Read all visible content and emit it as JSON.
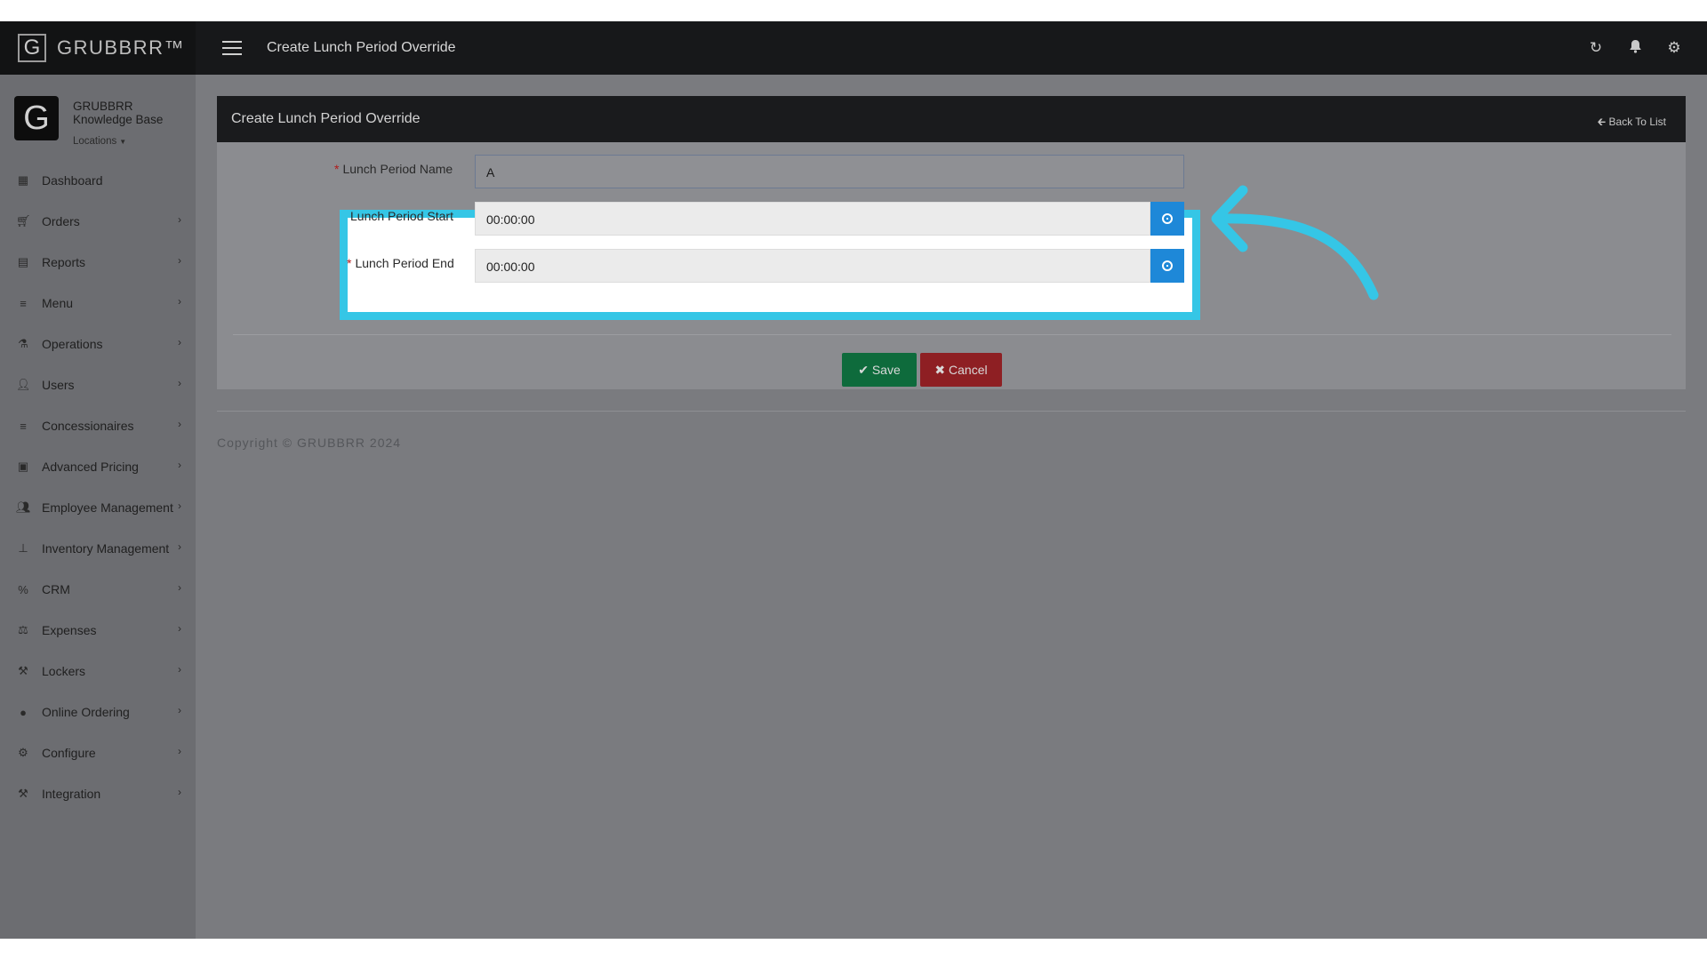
{
  "brand": {
    "logo_letter": "G",
    "name": "GRUBBRR™"
  },
  "topbar": {
    "title": "Create Lunch Period Override",
    "icons": [
      "refresh-icon",
      "bell-icon",
      "gear-icon"
    ]
  },
  "sidebar": {
    "avatar_letter": "G",
    "org_name": "GRUBBRR Knowledge Base",
    "locations_label": "Locations",
    "items": [
      {
        "label": "Dashboard",
        "icon": "dashboard-icon",
        "has_submenu": false
      },
      {
        "label": "Orders",
        "icon": "cart-icon",
        "has_submenu": true
      },
      {
        "label": "Reports",
        "icon": "report-icon",
        "has_submenu": true
      },
      {
        "label": "Menu",
        "icon": "list-icon",
        "has_submenu": true
      },
      {
        "label": "Operations",
        "icon": "flask-icon",
        "has_submenu": true
      },
      {
        "label": "Users",
        "icon": "user-plus-icon",
        "has_submenu": true
      },
      {
        "label": "Concessionaires",
        "icon": "list-icon",
        "has_submenu": true
      },
      {
        "label": "Advanced Pricing",
        "icon": "money-icon",
        "has_submenu": true
      },
      {
        "label": "Employee Management",
        "icon": "users-icon",
        "has_submenu": true
      },
      {
        "label": "Inventory Management",
        "icon": "sitemap-icon",
        "has_submenu": true
      },
      {
        "label": "CRM",
        "icon": "percent-icon",
        "has_submenu": true
      },
      {
        "label": "Expenses",
        "icon": "balance-icon",
        "has_submenu": true
      },
      {
        "label": "Lockers",
        "icon": "tools-icon",
        "has_submenu": true
      },
      {
        "label": "Online Ordering",
        "icon": "globe-icon",
        "has_submenu": true
      },
      {
        "label": "Configure",
        "icon": "gear-icon",
        "has_submenu": true
      },
      {
        "label": "Integration",
        "icon": "tools-icon",
        "has_submenu": true
      }
    ]
  },
  "panel": {
    "title": "Create Lunch Period Override",
    "back_label": "Back To List",
    "name_label": "Lunch Period Name",
    "name_value": "A",
    "start_label": "Lunch Period Start",
    "start_value": "00:00:00",
    "end_label": "Lunch Period End",
    "end_value": "00:00:00",
    "save_label": "Save",
    "cancel_label": "Cancel"
  },
  "footer": {
    "copyright": "Copyright © GRUBBRR 2024"
  },
  "colors": {
    "highlight": "#35c6e6",
    "time_button": "#1e88d8",
    "save": "#0e6b3c",
    "cancel": "#8e1f23"
  }
}
